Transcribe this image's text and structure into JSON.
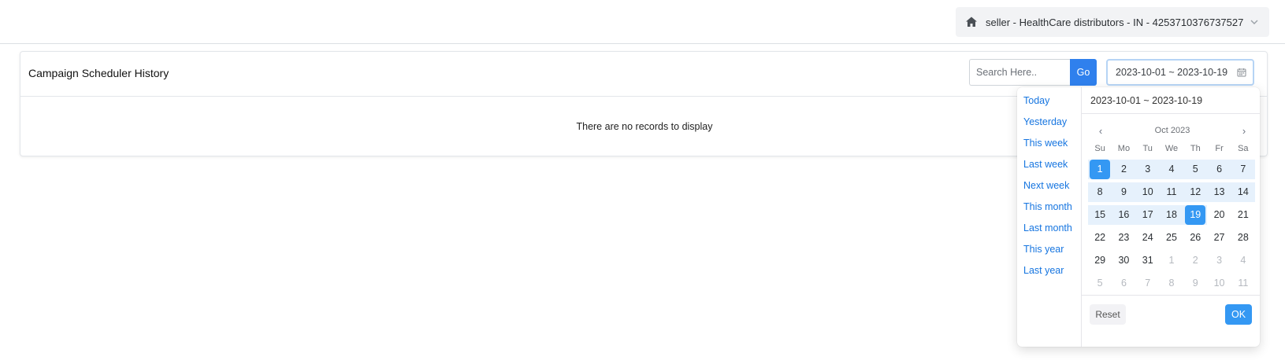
{
  "header": {
    "account_label": "seller - HealthCare distributors - IN - 4253710376737527",
    "home_icon": "home-icon",
    "dropdown_icon": "chevron-down-icon"
  },
  "card": {
    "title": "Campaign Scheduler History",
    "search_placeholder": "Search Here..",
    "go_label": "Go",
    "date_range_value": "2023-10-01 ~ 2023-10-19",
    "empty_message": "There are no records to display"
  },
  "picker": {
    "header_value": "2023-10-01 ~ 2023-10-19",
    "month_label": "Oct 2023",
    "prev_icon": "chevron-left-icon",
    "next_icon": "chevron-right-icon",
    "ranges": [
      "Today",
      "Yesterday",
      "This week",
      "Last week",
      "Next week",
      "This month",
      "Last month",
      "This year",
      "Last year"
    ],
    "weekdays": [
      "Su",
      "Mo",
      "Tu",
      "We",
      "Th",
      "Fr",
      "Sa"
    ],
    "weeks": [
      [
        "1",
        "2",
        "3",
        "4",
        "5",
        "6",
        "7"
      ],
      [
        "8",
        "9",
        "10",
        "11",
        "12",
        "13",
        "14"
      ],
      [
        "15",
        "16",
        "17",
        "18",
        "19",
        "20",
        "21"
      ],
      [
        "22",
        "23",
        "24",
        "25",
        "26",
        "27",
        "28"
      ],
      [
        "29",
        "30",
        "31",
        "1",
        "2",
        "3",
        "4"
      ],
      [
        "5",
        "6",
        "7",
        "8",
        "9",
        "10",
        "11"
      ]
    ],
    "selected_start": "1",
    "selected_end": "19",
    "reset_label": "Reset",
    "ok_label": "OK"
  },
  "colors": {
    "accent": "#3498f3",
    "go_button": "#2f80ed",
    "link": "#1675e0",
    "range_fill": "#e6f1fc"
  }
}
